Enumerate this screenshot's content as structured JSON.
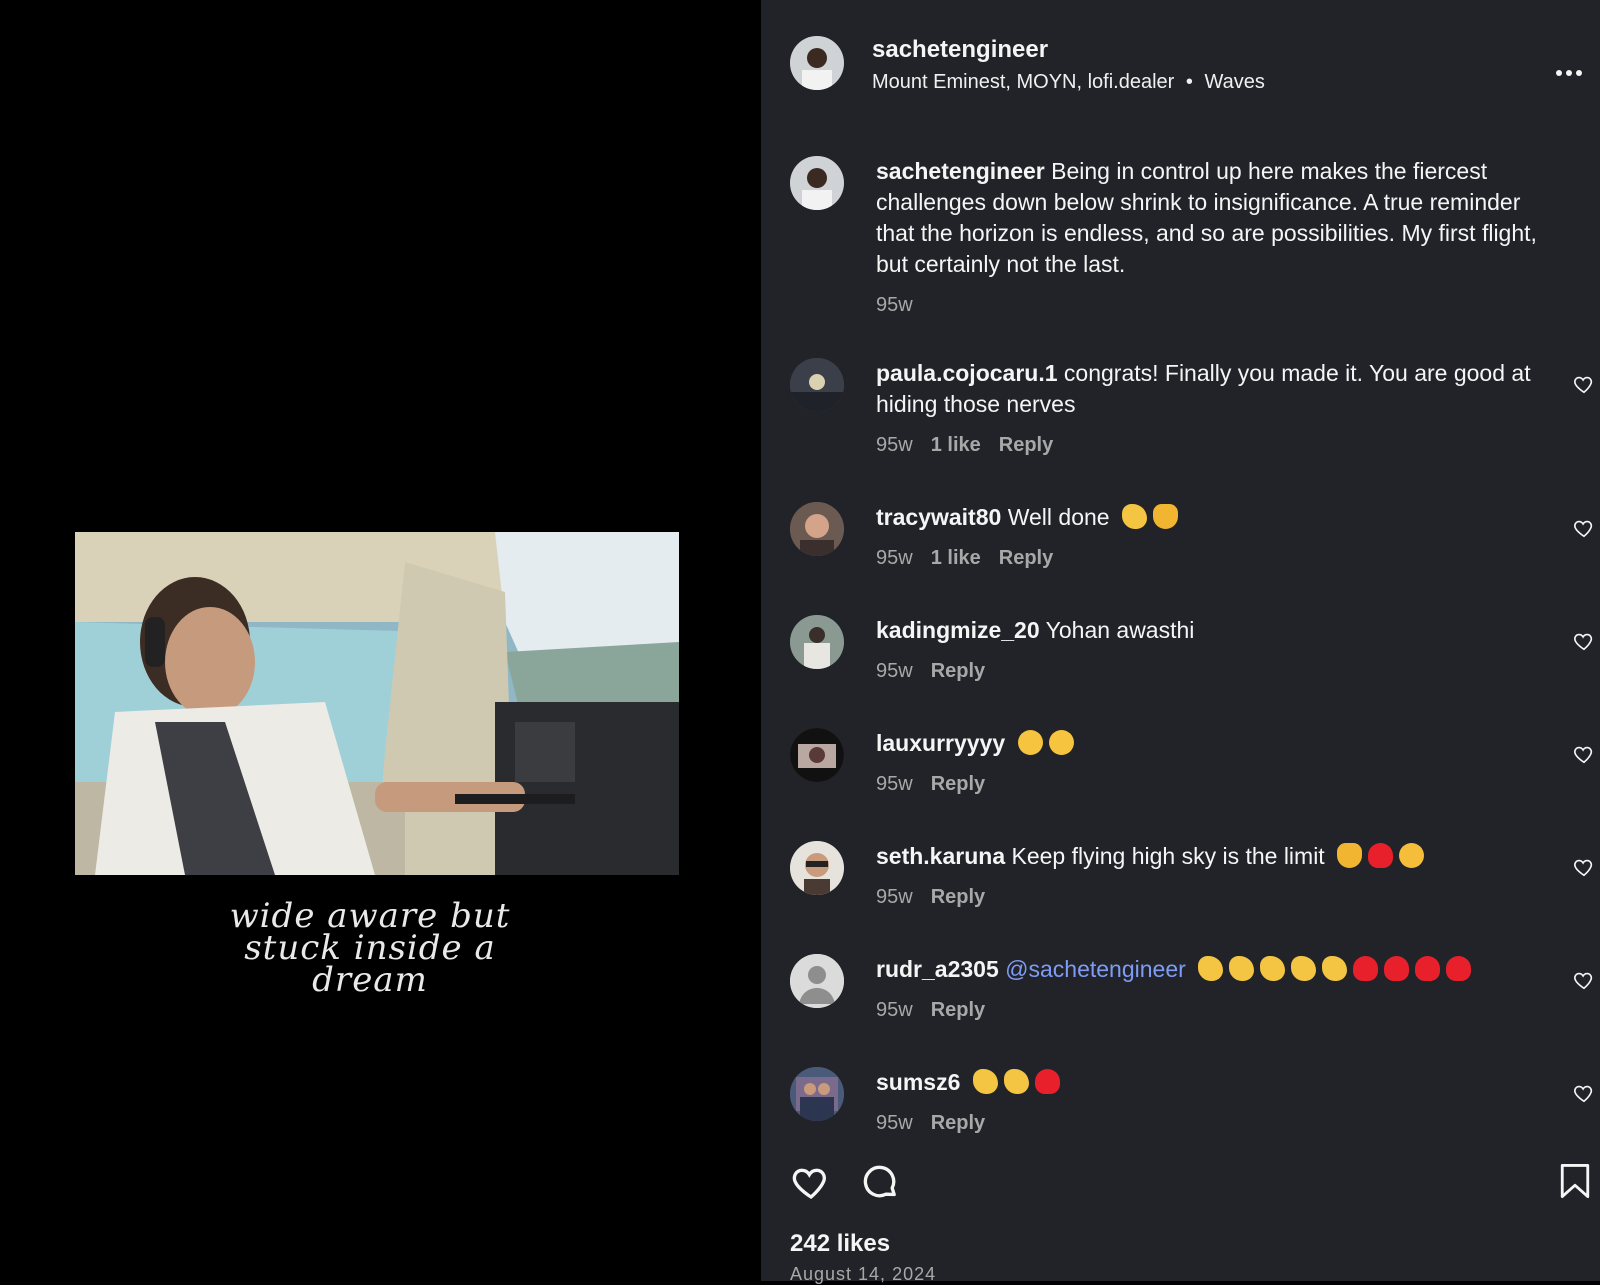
{
  "post": {
    "username": "sachetengineer",
    "subtitle_location": "Mount Eminest, MOYN, lofi.dealer",
    "subtitle_separator": "•",
    "subtitle_audio": "Waves",
    "more_icon": "more-options-icon",
    "media_caption_art": "wide aware but stuck inside a dream",
    "caption": {
      "username": "sachetengineer",
      "text": "Being in control up here makes the fiercest challenges down below shrink to insignificance. A true reminder that the horizon is endless, and so are possibilities. My first flight, but certainly not the last.",
      "time": "95w"
    }
  },
  "comments": [
    {
      "username": "paula.cojocaru.1",
      "text": "congrats! Finally you made it. You are good at hiding those nerves",
      "time": "95w",
      "likes": "1 like",
      "reply": "Reply"
    },
    {
      "username": "tracywait80",
      "text": "Well done",
      "emojis": [
        "clapping-hands",
        "raising-hands"
      ],
      "time": "95w",
      "likes": "1 like",
      "reply": "Reply"
    },
    {
      "username": "kadingmize_20",
      "text": "Yohan awasthi",
      "time": "95w",
      "reply": "Reply"
    },
    {
      "username": "lauxurryyyy",
      "text": "",
      "emojis": [
        "astonished-face",
        "astonished-face"
      ],
      "time": "95w",
      "reply": "Reply"
    },
    {
      "username": "seth.karuna",
      "text": "Keep flying high sky is the limit",
      "emojis": [
        "raising-hands",
        "red-heart",
        "heart-eyes-face"
      ],
      "time": "95w",
      "reply": "Reply"
    },
    {
      "username": "rudr_a2305",
      "mention": "@sachetengineer",
      "emojis": [
        "clapping-hands",
        "clapping-hands",
        "clapping-hands",
        "clapping-hands",
        "clapping-hands",
        "red-heart",
        "red-heart",
        "red-heart",
        "red-heart"
      ],
      "time": "95w",
      "reply": "Reply"
    },
    {
      "username": "sumsz6",
      "text": "",
      "emojis": [
        "clapping-hands",
        "clapping-hands",
        "red-heart"
      ],
      "time": "95w",
      "reply": "Reply"
    }
  ],
  "actions": {
    "like_icon": "heart-icon",
    "comment_icon": "comment-icon",
    "save_icon": "bookmark-icon"
  },
  "likes_count": "242 likes",
  "post_date": "August 14, 2024",
  "colors": {
    "panel_bg": "#212328",
    "mention": "#7f9cf5",
    "muted": "#a8a8a8"
  }
}
